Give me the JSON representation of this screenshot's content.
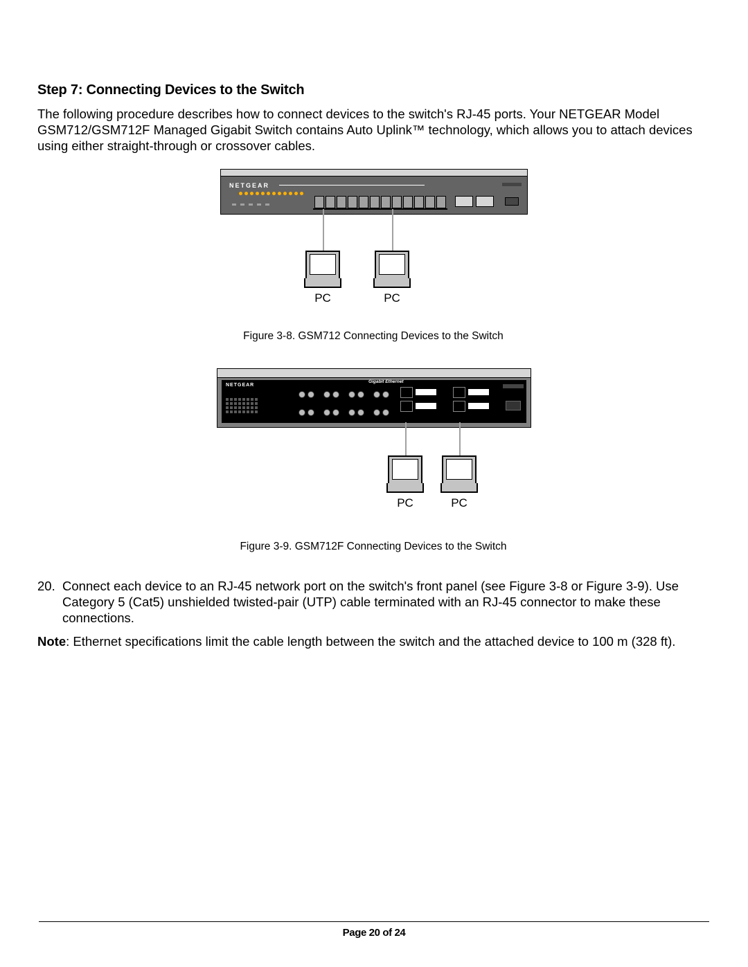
{
  "heading": "Step 7: Connecting Devices to the Switch",
  "intro": "The following procedure describes how to connect devices to the switch's RJ-45 ports. Your NETGEAR Model GSM712/GSM712F Managed Gigabit Switch contains Auto Uplink™ technology, which allows you to attach devices using either straight-through or crossover cables.",
  "figure1": {
    "brand": "NETGEAR",
    "pc_label": "PC",
    "caption": "Figure 3-8.  GSM712 Connecting Devices to the Switch"
  },
  "figure2": {
    "brand": "NETGEAR",
    "geth_label": "Gigabit Ethernet",
    "pc_label": "PC",
    "caption": "Figure 3-9.  GSM712F Connecting Devices to the Switch"
  },
  "step": {
    "number": "20.",
    "text": "Connect each device to an RJ-45 network port on the switch's front panel (see Figure 3-8 or Figure 3-9). Use Category 5 (Cat5) unshielded twisted-pair (UTP) cable terminated with an RJ-45 connector to make these connections."
  },
  "note_label": "Note",
  "note_text": ": Ethernet specifications limit the cable length between the switch and the attached device to 100 m (328 ft).",
  "footer": "Page 20 of 24"
}
